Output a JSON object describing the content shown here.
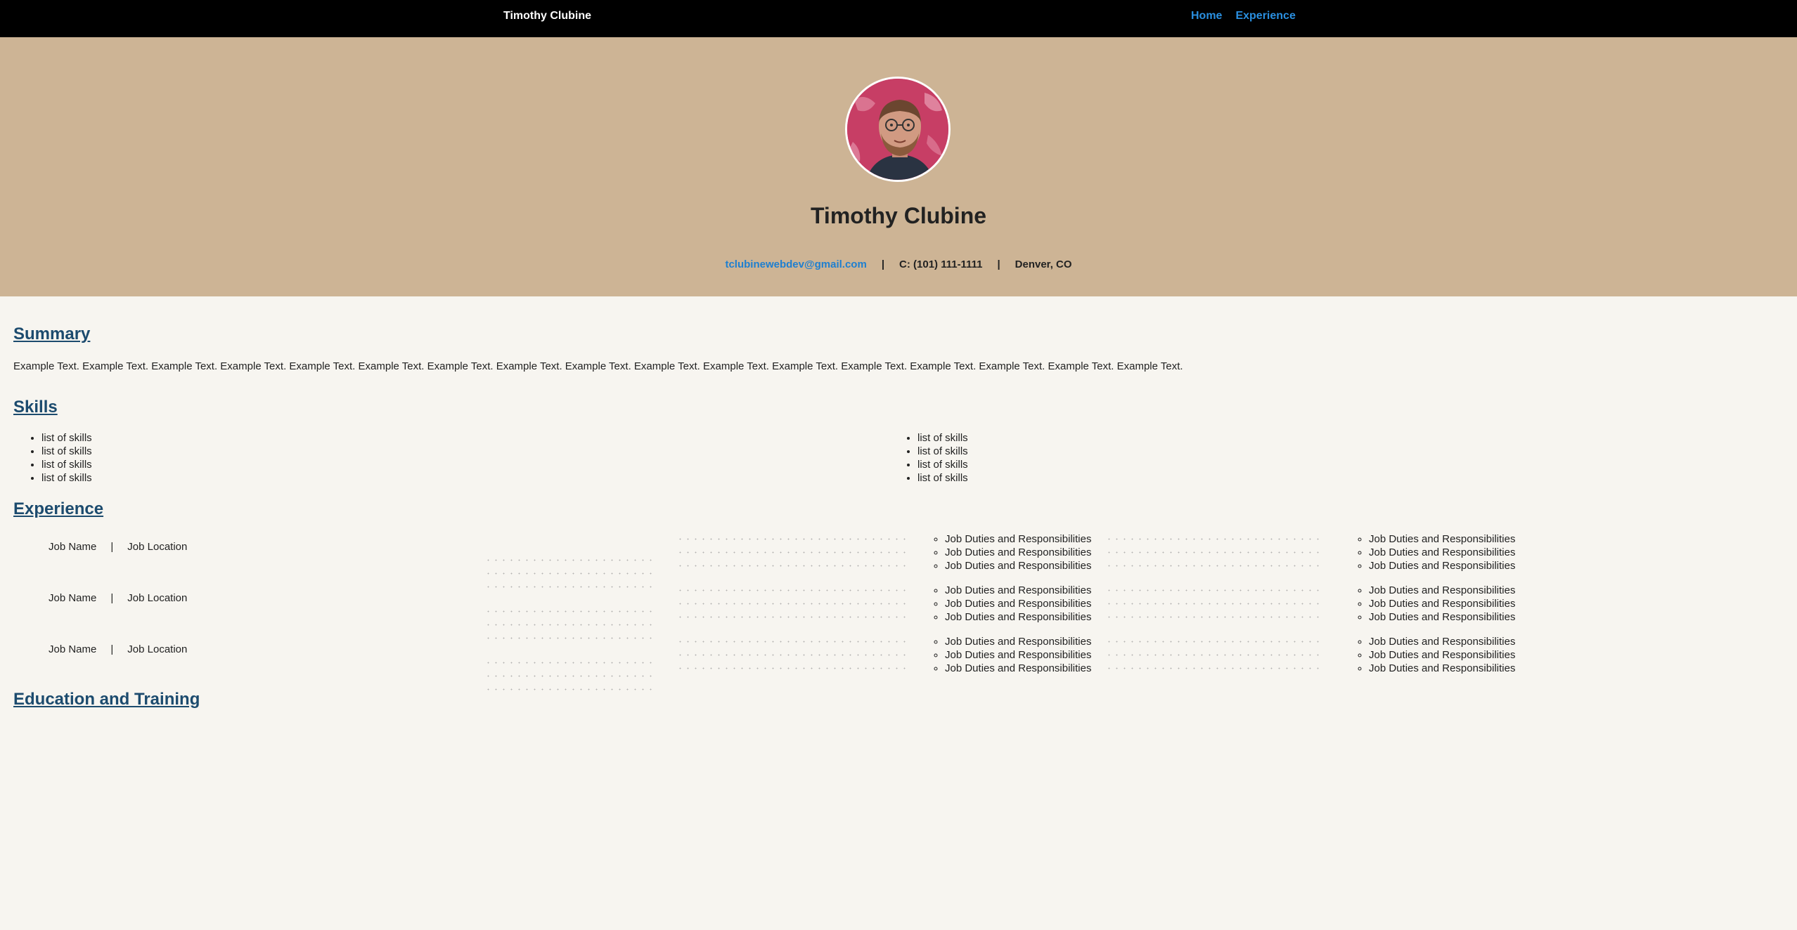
{
  "nav": {
    "brand": "Timothy Clubine",
    "links": [
      "Home",
      "Experience"
    ]
  },
  "hero": {
    "name": "Timothy Clubine",
    "email": "tclubinewebdev@gmail.com",
    "sep": "|",
    "phone": "C: (101) 111-1111",
    "location": "Denver, CO"
  },
  "summary": {
    "title": "Summary",
    "text": "Example Text. Example Text. Example Text. Example Text. Example Text. Example Text. Example Text. Example Text. Example Text. Example Text. Example Text. Example Text. Example Text. Example Text. Example Text. Example Text. Example Text."
  },
  "skills": {
    "title": "Skills",
    "left": [
      "list of skills",
      "list of skills",
      "list of skills",
      "list of skills"
    ],
    "right": [
      "list of skills",
      "list of skills",
      "list of skills",
      "list of skills"
    ]
  },
  "experience": {
    "title": "Experience",
    "jobs": [
      {
        "name": "Job Name",
        "sep": "|",
        "location": "Job Location",
        "duties_a": [
          "Job Duties and Responsibilities",
          "Job Duties and Responsibilities",
          "Job Duties and Responsibilities"
        ],
        "duties_b": [
          "Job Duties and Responsibilities",
          "Job Duties and Responsibilities",
          "Job Duties and Responsibilities"
        ]
      },
      {
        "name": "Job Name",
        "sep": "|",
        "location": "Job Location",
        "duties_a": [
          "Job Duties and Responsibilities",
          "Job Duties and Responsibilities",
          "Job Duties and Responsibilities"
        ],
        "duties_b": [
          "Job Duties and Responsibilities",
          "Job Duties and Responsibilities",
          "Job Duties and Responsibilities"
        ]
      },
      {
        "name": "Job Name",
        "sep": "|",
        "location": "Job Location",
        "duties_a": [
          "Job Duties and Responsibilities",
          "Job Duties and Responsibilities",
          "Job Duties and Responsibilities"
        ],
        "duties_b": [
          "Job Duties and Responsibilities",
          "Job Duties and Responsibilities",
          "Job Duties and Responsibilities"
        ]
      }
    ]
  },
  "education": {
    "title": "Education and Training"
  },
  "colors": {
    "navbar": "#000000",
    "hero": "#cdb495",
    "page": "#f7f5f0",
    "heading": "#1c4b6e",
    "link": "#2a8fe0"
  }
}
